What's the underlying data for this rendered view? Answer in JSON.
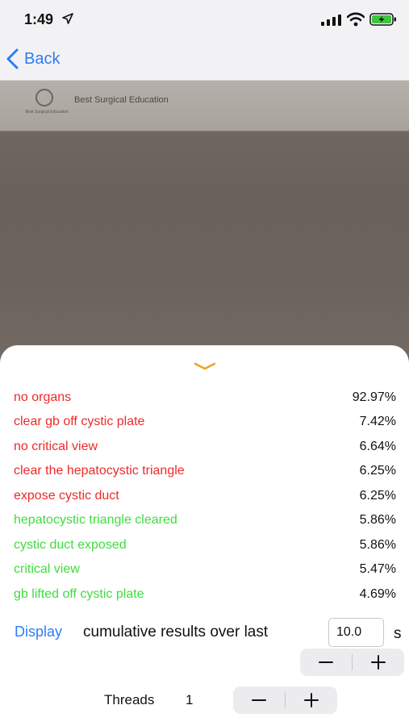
{
  "status_bar": {
    "time": "1:49"
  },
  "nav": {
    "back_label": "Back"
  },
  "camera": {
    "logo_caption": "Best Surgical Education",
    "banner_title": "Best Surgical Education"
  },
  "results": [
    {
      "label": "no organs",
      "value": "92.97%",
      "color": "#ee2a2a"
    },
    {
      "label": "clear gb off cystic plate",
      "value": "7.42%",
      "color": "#ee2a2a"
    },
    {
      "label": "no critical view",
      "value": "6.64%",
      "color": "#ee2a2a"
    },
    {
      "label": "clear the hepatocystic triangle",
      "value": "6.25%",
      "color": "#ee2a2a"
    },
    {
      "label": "expose cystic duct",
      "value": "6.25%",
      "color": "#ee2a2a"
    },
    {
      "label": "hepatocystic triangle cleared",
      "value": "5.86%",
      "color": "#3fdc3f"
    },
    {
      "label": "cystic duct exposed",
      "value": "5.86%",
      "color": "#3fdc3f"
    },
    {
      "label": "critical view",
      "value": "5.47%",
      "color": "#3fdc3f"
    },
    {
      "label": "gb lifted off cystic plate",
      "value": "4.69%",
      "color": "#3fdc3f"
    }
  ],
  "controls": {
    "display_label": "Display",
    "cumulative_text": "cumulative results over last",
    "interval_value": "10.0",
    "interval_unit": "s",
    "threads_label": "Threads",
    "threads_value": "1"
  },
  "colors": {
    "accent": "#2f7cf6",
    "handle": "#f0a020",
    "negative": "#ee2a2a",
    "positive": "#3fdc3f"
  }
}
